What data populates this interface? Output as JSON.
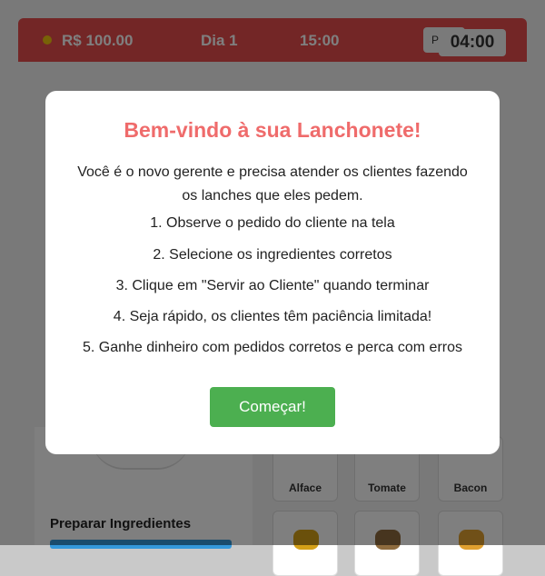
{
  "header": {
    "money": "R$ 100.00",
    "day": "Dia 1",
    "clock": "15:00",
    "pause_label": "P",
    "timer": "04:00"
  },
  "prep": {
    "title": "Preparar Ingredientes"
  },
  "ingredients": [
    {
      "label": "Alface",
      "color": "#7cb342"
    },
    {
      "label": "Tomate",
      "color": "#e53935"
    },
    {
      "label": "Bacon",
      "color": "#a0522d"
    }
  ],
  "modal": {
    "title": "Bem-vindo à sua Lanchonete!",
    "intro": "Você é o novo gerente e precisa atender os clientes fazendo os lanches que eles pedem.",
    "steps": [
      "1. Observe o pedido do cliente na tela",
      "2. Selecione os ingredientes corretos",
      "3. Clique em \"Servir ao Cliente\" quando terminar",
      "4. Seja rápido, os clientes têm paciência limitada!",
      "5. Ganhe dinheiro com pedidos corretos e perca com erros"
    ],
    "start_label": "Começar!"
  },
  "colors": {
    "header": "#e74c4c",
    "accent_title": "#ef6b6b",
    "start_button": "#4caf50"
  }
}
